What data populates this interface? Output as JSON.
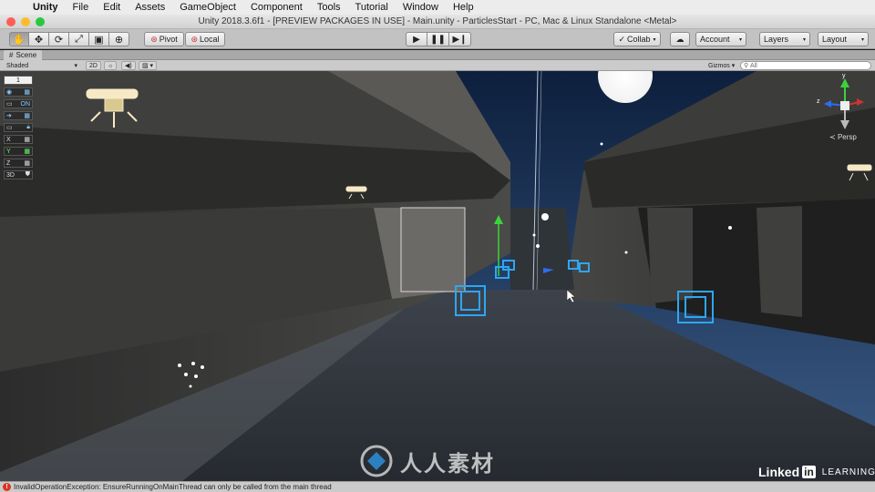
{
  "menubar": {
    "items": [
      {
        "label": "Unity"
      },
      {
        "label": "File"
      },
      {
        "label": "Edit"
      },
      {
        "label": "Assets"
      },
      {
        "label": "GameObject"
      },
      {
        "label": "Component"
      },
      {
        "label": "Tools"
      },
      {
        "label": "Tutorial"
      },
      {
        "label": "Window"
      },
      {
        "label": "Help"
      }
    ]
  },
  "window": {
    "title": "Unity 2018.3.6f1 - [PREVIEW PACKAGES IN USE] - Main.unity - ParticlesStart - PC, Mac & Linux Standalone <Metal>",
    "lights": [
      "#fc5f57",
      "#fdbc2e",
      "#28c840"
    ]
  },
  "toolbar": {
    "tools": [
      "hand-icon",
      "move-icon",
      "rotate-icon",
      "scale-icon",
      "rect-icon",
      "transform-icon"
    ],
    "pivot_label": "Pivot",
    "local_label": "Local",
    "collab_label": "Collab",
    "account_label": "Account",
    "layers_label": "Layers",
    "layout_label": "Layout"
  },
  "scene": {
    "tab_label": "Scene",
    "shading_mode": "Shaded",
    "mode_2d": "2D",
    "gizmos_label": "Gizmos",
    "search_placeholder": "All"
  },
  "overlay": {
    "count": "1",
    "toggle_on": "ON",
    "axes": [
      "X",
      "Y",
      "Z"
    ],
    "mode_3d": "3D"
  },
  "gizmo": {
    "y_label": "y",
    "z_label": "z",
    "persp_label": "Persp"
  },
  "status": {
    "message": "InvalidOperationException: EnsureRunningOnMainThread can only be called from the main thread"
  },
  "watermark": {
    "text": "人人素材",
    "linkedin_left": "Linked",
    "linkedin_in": "in",
    "linkedin_learning": "LEARNING"
  },
  "colors": {
    "accent_blue": "#1e7fd8",
    "error_red": "#dd3322",
    "sky_top": "#0d1f3d",
    "sky_bottom": "#3c5d88"
  }
}
